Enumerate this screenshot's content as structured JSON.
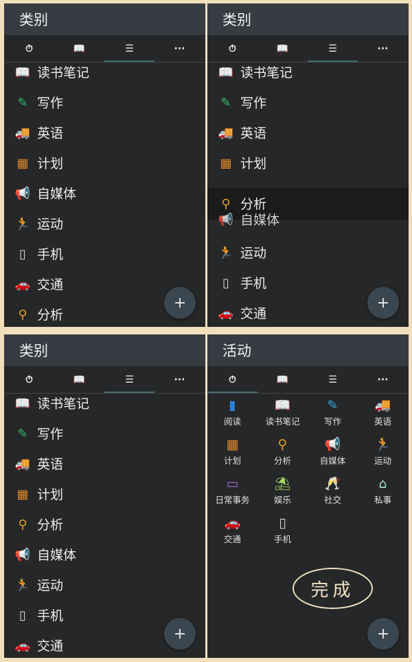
{
  "colors": {
    "background": "#f1debb",
    "panel": "#262728",
    "header": "#363c42",
    "accent": "#3e6f73"
  },
  "tabs_icons": [
    "stopwatch-icon",
    "book-icon",
    "list-icon",
    "more-icon"
  ],
  "panel_tl": {
    "title": "类别",
    "items": [
      {
        "label": "读书笔记",
        "icon": "open-book-icon",
        "color": "#2fbf8f"
      },
      {
        "label": "写作",
        "icon": "quill-icon",
        "color": "#2fbf6a"
      },
      {
        "label": "英语",
        "icon": "truck-icon",
        "color": "#4caf2a"
      },
      {
        "label": "计划",
        "icon": "calendar-icon",
        "color": "#e0892a"
      },
      {
        "label": "自媒体",
        "icon": "megaphone-icon",
        "color": "#2aa6d8"
      },
      {
        "label": "运动",
        "icon": "runner-icon",
        "color": "#4a78e0"
      },
      {
        "label": "手机",
        "icon": "phone-icon",
        "color": "#d9d9d9"
      },
      {
        "label": "交通",
        "icon": "car-icon",
        "color": "#9aa5ad"
      },
      {
        "label": "分析",
        "icon": "analysis-icon",
        "color": "#e0a02a"
      }
    ],
    "fab": "+"
  },
  "panel_tr": {
    "title": "类别",
    "items_top": [
      {
        "label": "读书笔记",
        "icon": "open-book-icon",
        "color": "#2fbf8f"
      },
      {
        "label": "写作",
        "icon": "quill-icon",
        "color": "#2fbf6a"
      },
      {
        "label": "英语",
        "icon": "truck-icon",
        "color": "#4caf2a"
      },
      {
        "label": "计划",
        "icon": "calendar-icon",
        "color": "#e0892a"
      }
    ],
    "dragging": {
      "label": "分析",
      "behind_label": "自媒体"
    },
    "items_bottom": [
      {
        "label": "运动",
        "icon": "runner-icon",
        "color": "#4a78e0"
      },
      {
        "label": "手机",
        "icon": "phone-icon",
        "color": "#d9d9d9"
      },
      {
        "label": "交通",
        "icon": "car-icon",
        "color": "#9aa5ad"
      }
    ],
    "fab": "+"
  },
  "panel_bl": {
    "title": "类别",
    "items": [
      {
        "label": "读书笔记",
        "icon": "open-book-icon",
        "color": "#2fbf8f"
      },
      {
        "label": "写作",
        "icon": "quill-icon",
        "color": "#2fbf6a"
      },
      {
        "label": "英语",
        "icon": "truck-icon",
        "color": "#4caf2a"
      },
      {
        "label": "计划",
        "icon": "calendar-icon",
        "color": "#e0892a"
      },
      {
        "label": "分析",
        "icon": "analysis-icon",
        "color": "#e0a02a"
      },
      {
        "label": "自媒体",
        "icon": "megaphone-icon",
        "color": "#2aa6d8"
      },
      {
        "label": "运动",
        "icon": "runner-icon",
        "color": "#4a78e0"
      },
      {
        "label": "手机",
        "icon": "phone-icon",
        "color": "#d9d9d9"
      },
      {
        "label": "交通",
        "icon": "car-icon",
        "color": "#9aa5ad"
      }
    ],
    "fab": "+"
  },
  "panel_br": {
    "title": "活动",
    "activities": [
      {
        "label": "阅读",
        "icon": "book-icon",
        "color": "#2d7fd8"
      },
      {
        "label": "读书笔记",
        "icon": "open-book-icon",
        "color": "#2a9ad8"
      },
      {
        "label": "写作",
        "icon": "quill-icon",
        "color": "#2aa6d8"
      },
      {
        "label": "英语",
        "icon": "truck-icon",
        "color": "#2aa6d8"
      },
      {
        "label": "计划",
        "icon": "calendar-icon",
        "color": "#e0892a"
      },
      {
        "label": "分析",
        "icon": "analysis-icon",
        "color": "#e0a02a"
      },
      {
        "label": "自媒体",
        "icon": "megaphone-icon",
        "color": "#7b2fd8"
      },
      {
        "label": "运动",
        "icon": "runner-icon",
        "color": "#8a4ae0"
      },
      {
        "label": "日常事务",
        "icon": "laptop-icon",
        "color": "#9a6ad8"
      },
      {
        "label": "娱乐",
        "icon": "beach-icon",
        "color": "#a8d86a"
      },
      {
        "label": "社交",
        "icon": "cheers-icon",
        "color": "#bfe0a8"
      },
      {
        "label": "私事",
        "icon": "house-icon",
        "color": "#a8e0c8"
      },
      {
        "label": "交通",
        "icon": "car-icon",
        "color": "#9aa5ad"
      },
      {
        "label": "手机",
        "icon": "phone-icon",
        "color": "#d9d9d9"
      }
    ],
    "done_label": "完成",
    "fab": "+"
  }
}
